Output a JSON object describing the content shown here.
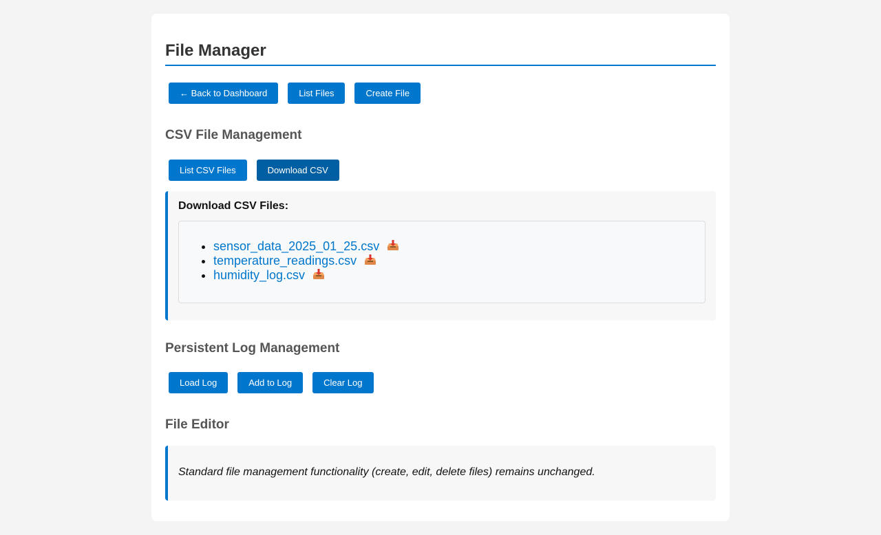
{
  "header": {
    "title": "File Manager"
  },
  "toolbar": {
    "back_label": "← Back to Dashboard",
    "list_files_label": "List Files",
    "create_file_label": "Create File"
  },
  "csv_section": {
    "title": "CSV File Management",
    "list_label": "List CSV Files",
    "download_label": "Download CSV",
    "panel_heading": "Download CSV Files:",
    "files": [
      {
        "name": "sensor_data_2025_01_25.csv",
        "icon": "inbox-tray-download-icon"
      },
      {
        "name": "temperature_readings.csv",
        "icon": "inbox-tray-download-icon"
      },
      {
        "name": "humidity_log.csv",
        "icon": "inbox-tray-download-icon"
      }
    ]
  },
  "log_section": {
    "title": "Persistent Log Management",
    "load_label": "Load Log",
    "add_label": "Add to Log",
    "clear_label": "Clear Log"
  },
  "editor_section": {
    "title": "File Editor",
    "note": "Standard file management functionality (create, edit, delete files) remains unchanged."
  },
  "colors": {
    "accent": "#0077cc",
    "accent_active": "#005fa3",
    "background": "#f4f4f4",
    "panel": "#f7f7f7"
  }
}
